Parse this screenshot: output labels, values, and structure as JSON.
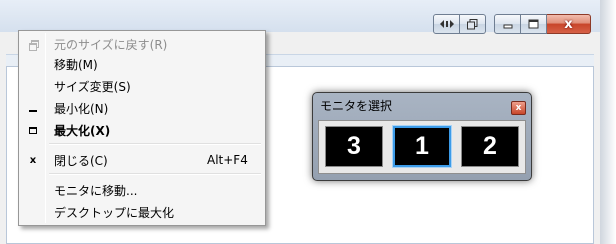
{
  "context_menu": {
    "items": [
      {
        "icon": "restore-icon",
        "label": "元のサイズに戻す(R)",
        "accel": "",
        "disabled": true,
        "bold": false
      },
      {
        "icon": "",
        "label": "移動(M)",
        "accel": "",
        "disabled": false,
        "bold": false
      },
      {
        "icon": "",
        "label": "サイズ変更(S)",
        "accel": "",
        "disabled": false,
        "bold": false
      },
      {
        "icon": "minimize-icon",
        "label": "最小化(N)",
        "accel": "",
        "disabled": false,
        "bold": false
      },
      {
        "icon": "maximize-icon",
        "label": "最大化(X)",
        "accel": "",
        "disabled": false,
        "bold": true
      },
      {
        "icon": "close-icon",
        "label": "閉じる(C)",
        "accel": "Alt+F4",
        "disabled": false,
        "bold": false
      },
      {
        "icon": "",
        "label": "モニタに移動...",
        "accel": "",
        "disabled": false,
        "bold": false
      },
      {
        "icon": "",
        "label": "デスクトップに最大化",
        "accel": "",
        "disabled": false,
        "bold": false
      }
    ]
  },
  "monitor_dialog": {
    "title": "モニタを選択",
    "close_glyph": "x",
    "monitors": [
      {
        "label": "3",
        "selected": false
      },
      {
        "label": "1",
        "selected": true
      },
      {
        "label": "2",
        "selected": false
      }
    ]
  },
  "window_caption": {
    "close_glyph": "x"
  },
  "colors": {
    "close_button": "#c8462a",
    "selected_monitor_border": "#3c9be8",
    "monitor_button_bg": "#000000"
  }
}
